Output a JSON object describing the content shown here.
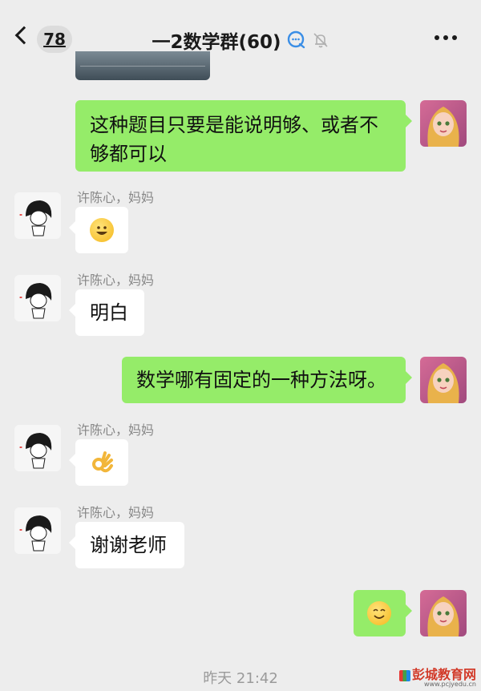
{
  "header": {
    "unread_count": "78",
    "title": "一2数学群(60)"
  },
  "messages": [
    {
      "side": "right",
      "text": "这种题目只要是能说明够、或者不够都可以"
    },
    {
      "side": "left",
      "sender": "许陈心，妈妈",
      "emoji": "grinning-face"
    },
    {
      "side": "left",
      "sender": "许陈心，妈妈",
      "text": "明白"
    },
    {
      "side": "right",
      "text": "数学哪有固定的一种方法呀。"
    },
    {
      "side": "left",
      "sender": "许陈心，妈妈",
      "emoji": "ok-hand"
    },
    {
      "side": "left",
      "sender": "许陈心，妈妈",
      "text": "谢谢老师"
    },
    {
      "side": "right",
      "emoji": "smiling-face"
    }
  ],
  "timestamp": "昨天 21:42",
  "watermark": {
    "text": "彭城教育网",
    "url": "www.pcjyedu.cn"
  },
  "colors": {
    "background": "#ededed",
    "outgoing_bubble": "#95ec69",
    "incoming_bubble": "#ffffff"
  }
}
